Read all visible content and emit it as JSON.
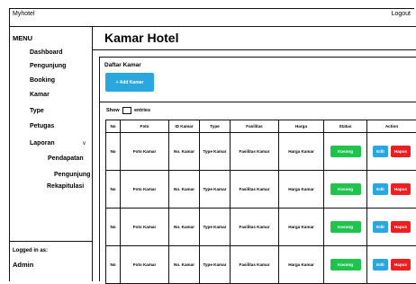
{
  "app": {
    "title": "Myhotel",
    "logout_label": "Logout"
  },
  "sidebar": {
    "menu_title": "MENU",
    "items": {
      "dashboard": "Dashboard",
      "pengunjung": "Pengunjung",
      "booking": "Booking",
      "kamar": "Kamar",
      "type": "Type",
      "petugas": "Petugas",
      "laporan": "Laporan",
      "laporan_caret": "v",
      "pendapatan": "Pendapatan",
      "pengunjung_report": "Pengunjung",
      "rekapitulasi": "Rekapitulasi"
    },
    "logged_in_label": "Logged in as:",
    "user": "Admin"
  },
  "page": {
    "title": "Kamar Hotel"
  },
  "card": {
    "title": "Daftar Kamar",
    "add_button": "+ Add Kamar",
    "show_label": "Show",
    "entries_label": "entries"
  },
  "table": {
    "headers": {
      "no": "No",
      "foto": "Foto",
      "id_kamar": "ID Kamar",
      "type": "Type",
      "fasilitas": "Fasilitas",
      "harga": "Harga",
      "status": "Status",
      "action": "Action"
    },
    "rows": [
      {
        "no": "No",
        "foto": "Foto Kamar",
        "id": "No. Kamar",
        "type": "Type Kamar",
        "fasilitas": "Fasilitas Kamar",
        "harga": "Harga Kamar",
        "status": "Kosong",
        "edit": "Edit",
        "hapus": "Hapus"
      },
      {
        "no": "No",
        "foto": "Foto Kamar",
        "id": "No. Kamar",
        "type": "Type Kamar",
        "fasilitas": "Fasilitas Kamar",
        "harga": "Harga Kamar",
        "status": "Kosong",
        "edit": "Edit",
        "hapus": "Hapus"
      },
      {
        "no": "No",
        "foto": "Foto Kamar",
        "id": "No. Kamar",
        "type": "Type Kamar",
        "fasilitas": "Fasilitas Kamar",
        "harga": "Harga Kamar",
        "status": "Kosong",
        "edit": "Edit",
        "hapus": "Hapus"
      },
      {
        "no": "No",
        "foto": "Foto Kamar",
        "id": "No. Kamar",
        "type": "Type Kamar",
        "fasilitas": "Fasilitas Kamar",
        "harga": "Harga Kamar",
        "status": "Kosong",
        "edit": "Edit",
        "hapus": "Hapus"
      }
    ]
  },
  "colors": {
    "primary": "#2aa7df",
    "success": "#1fc34d",
    "danger": "#ef1f1f"
  }
}
